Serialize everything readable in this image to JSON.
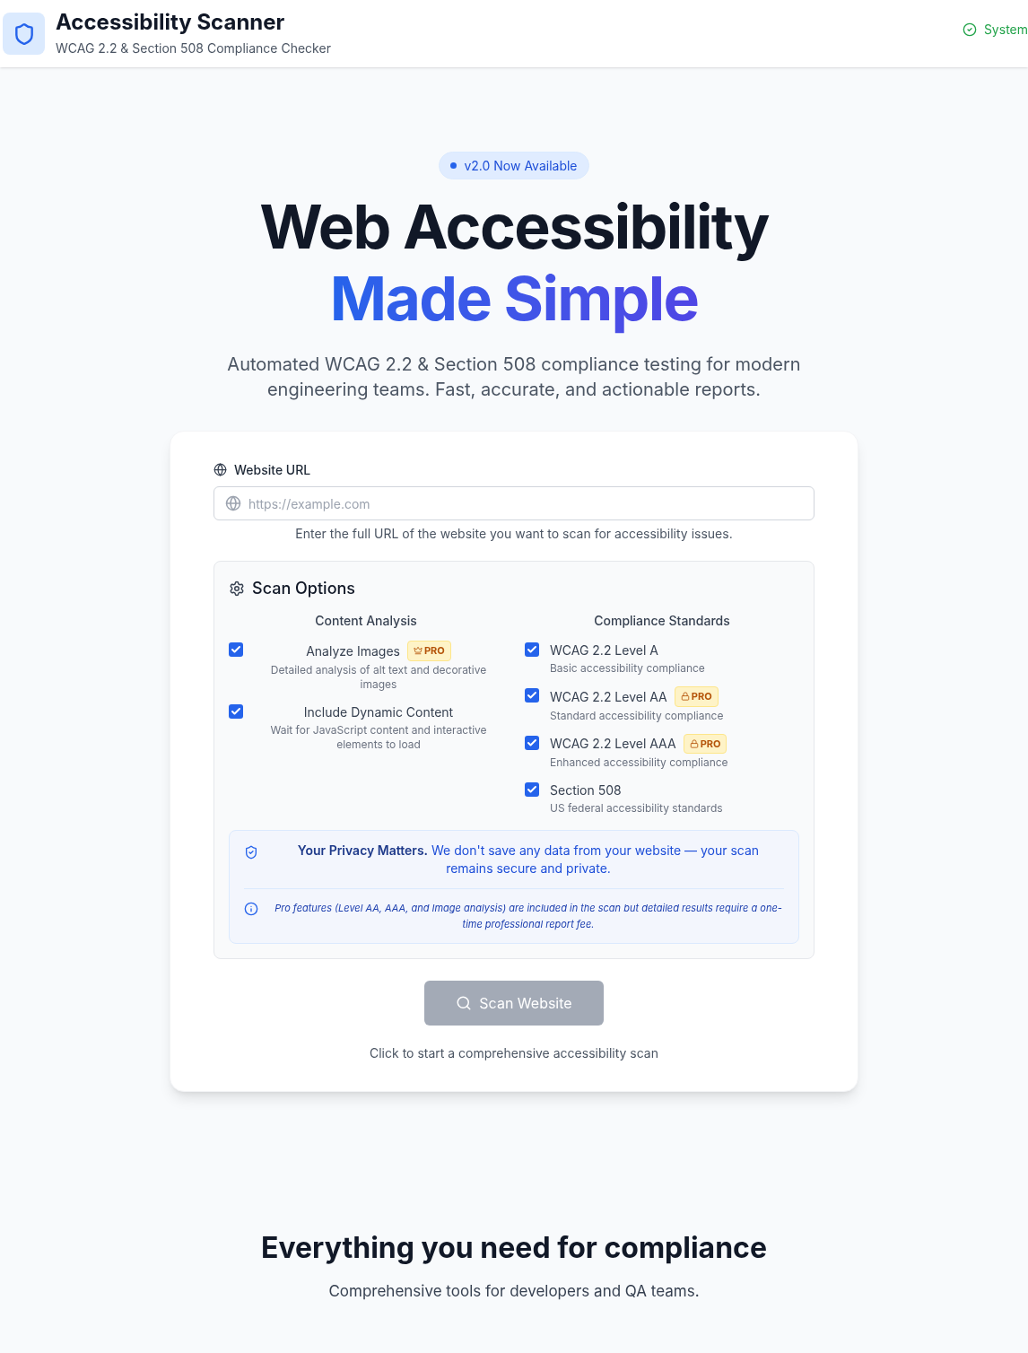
{
  "header": {
    "title": "Accessibility Scanner",
    "subtitle": "WCAG 2.2 & Section 508 Compliance Checker",
    "status": "System"
  },
  "hero": {
    "badge": "v2.0 Now Available",
    "title_line_1": "Web Accessibility",
    "title_line_2": "Made Simple",
    "description": "Automated WCAG 2.2 & Section 508 compliance testing for modern engineering teams. Fast, accurate, and actionable reports."
  },
  "form": {
    "url_label": "Website URL",
    "url_placeholder": "https://example.com",
    "url_help": "Enter the full URL of the website you want to scan for accessibility issues.",
    "options_title": "Scan Options",
    "groups": [
      {
        "title": "Content Analysis",
        "items": [
          {
            "label": "Analyze Images",
            "description": "Detailed analysis of alt text and decorative images",
            "checked": true,
            "badge": {
              "label": "PRO",
              "kind": "crown"
            }
          },
          {
            "label": "Include Dynamic Content",
            "description": "Wait for JavaScript content and interactive elements to load",
            "checked": true
          }
        ]
      },
      {
        "title": "Compliance Standards",
        "items": [
          {
            "label": "WCAG 2.2 Level A",
            "description": "Basic accessibility compliance",
            "checked": true
          },
          {
            "label": "WCAG 2.2 Level AA",
            "description": "Standard accessibility compliance",
            "checked": true,
            "badge": {
              "label": "PRO",
              "kind": "lock"
            }
          },
          {
            "label": "WCAG 2.2 Level AAA",
            "description": "Enhanced accessibility compliance",
            "checked": true,
            "badge": {
              "label": "PRO",
              "kind": "lock"
            }
          },
          {
            "label": "Section 508",
            "description": "US federal accessibility standards",
            "checked": true
          }
        ]
      }
    ],
    "privacy": "**Your Privacy Matters.** We don't save any data from your website — your scan remains secure and private.",
    "pro_note": "Pro features (Level AA, AAA, and Image analysis) are included in the scan but detailed results require a one-time professional report fee.",
    "scan_button": {
      "label": "Scan Website",
      "disabled": true
    },
    "scan_hint": "Click to start a comprehensive accessibility scan"
  },
  "features": {
    "title": "Everything you need for compliance",
    "subtitle": "Comprehensive tools for developers and QA teams."
  }
}
